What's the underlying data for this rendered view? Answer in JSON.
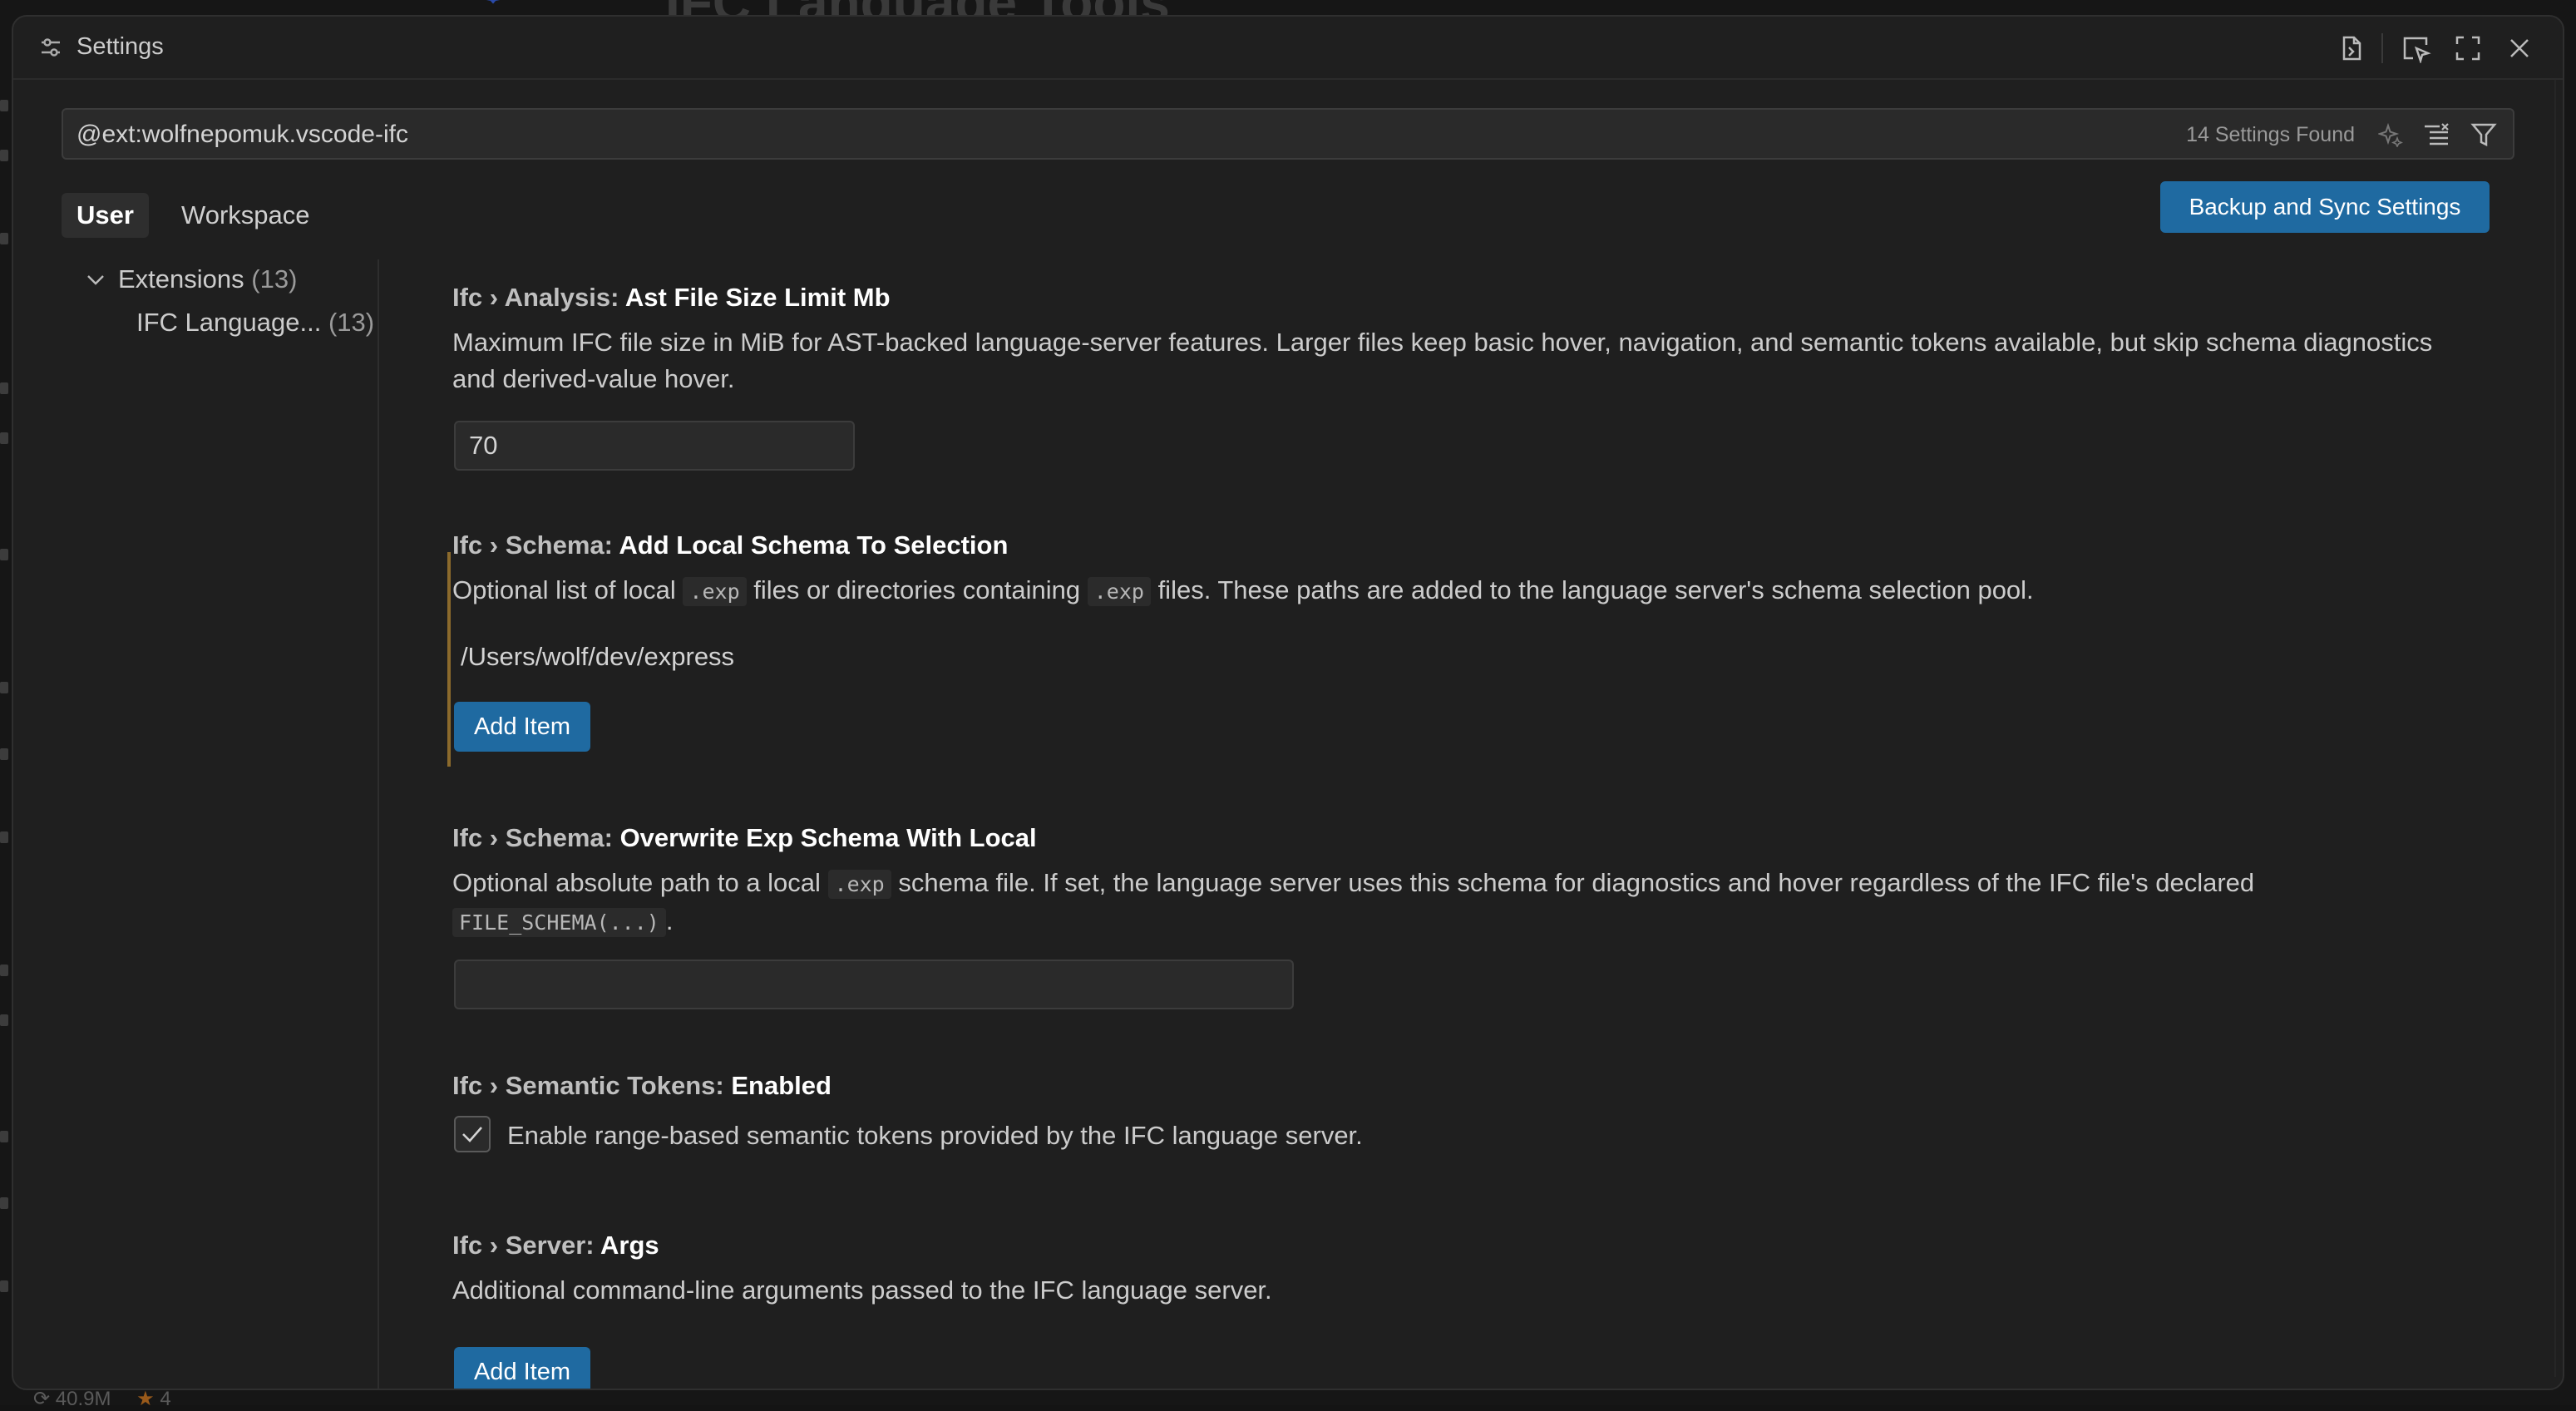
{
  "window": {
    "title": "Settings"
  },
  "background": {
    "title": "IFC Language Tools",
    "status_downloads": "40.9M",
    "status_rating": "4"
  },
  "search": {
    "query": "@ext:wolfnepomuk.vscode-ifc",
    "result_count": "14 Settings Found"
  },
  "scopes": {
    "user": "User",
    "workspace": "Workspace",
    "active": "User"
  },
  "sync_button": "Backup and Sync Settings",
  "tree": {
    "extensions_label": "Extensions",
    "extensions_count": "(13)",
    "ifc_label": "IFC Language...",
    "ifc_count": "(13)"
  },
  "settings": [
    {
      "category": "Ifc › Analysis: ",
      "name": "Ast File Size Limit Mb",
      "description": "Maximum IFC file size in MiB for AST-backed language-server features. Larger files keep basic hover, navigation, and semantic tokens available, but skip schema diagnostics and derived-value hover.",
      "value": "70"
    },
    {
      "category": "Ifc › Schema: ",
      "name": "Add Local Schema To Selection",
      "description_parts": [
        "Optional list of local ",
        ".exp",
        " files or directories containing ",
        ".exp",
        " files. These paths are added to the language server's schema selection pool."
      ],
      "items": [
        "/Users/wolf/dev/express"
      ],
      "add_label": "Add Item"
    },
    {
      "category": "Ifc › Schema: ",
      "name": "Overwrite Exp Schema With Local",
      "description_parts": [
        "Optional absolute path to a local ",
        ".exp",
        " schema file. If set, the language server uses this schema for diagnostics and hover regardless of the IFC file's declared ",
        "FILE_SCHEMA(...)",
        "."
      ],
      "value": ""
    },
    {
      "category": "Ifc › Semantic Tokens: ",
      "name": "Enabled",
      "checkbox_label": "Enable range-based semantic tokens provided by the IFC language server.",
      "checked": true
    },
    {
      "category": "Ifc › Server: ",
      "name": "Args",
      "description": "Additional command-line arguments passed to the IFC language server.",
      "add_label": "Add Item"
    }
  ],
  "colors": {
    "accent": "#1f6aa1",
    "modified_indicator": "#8b6a2c",
    "background": "#1f1f1f"
  },
  "icons": {
    "title": "settings-sliders-icon",
    "actions": [
      "open-json-icon",
      "select-element-icon",
      "maximize-icon",
      "close-icon"
    ],
    "search": [
      "sparkle-icon",
      "clear-filter-icon",
      "filter-icon"
    ],
    "tree": "chevron-down-icon"
  }
}
